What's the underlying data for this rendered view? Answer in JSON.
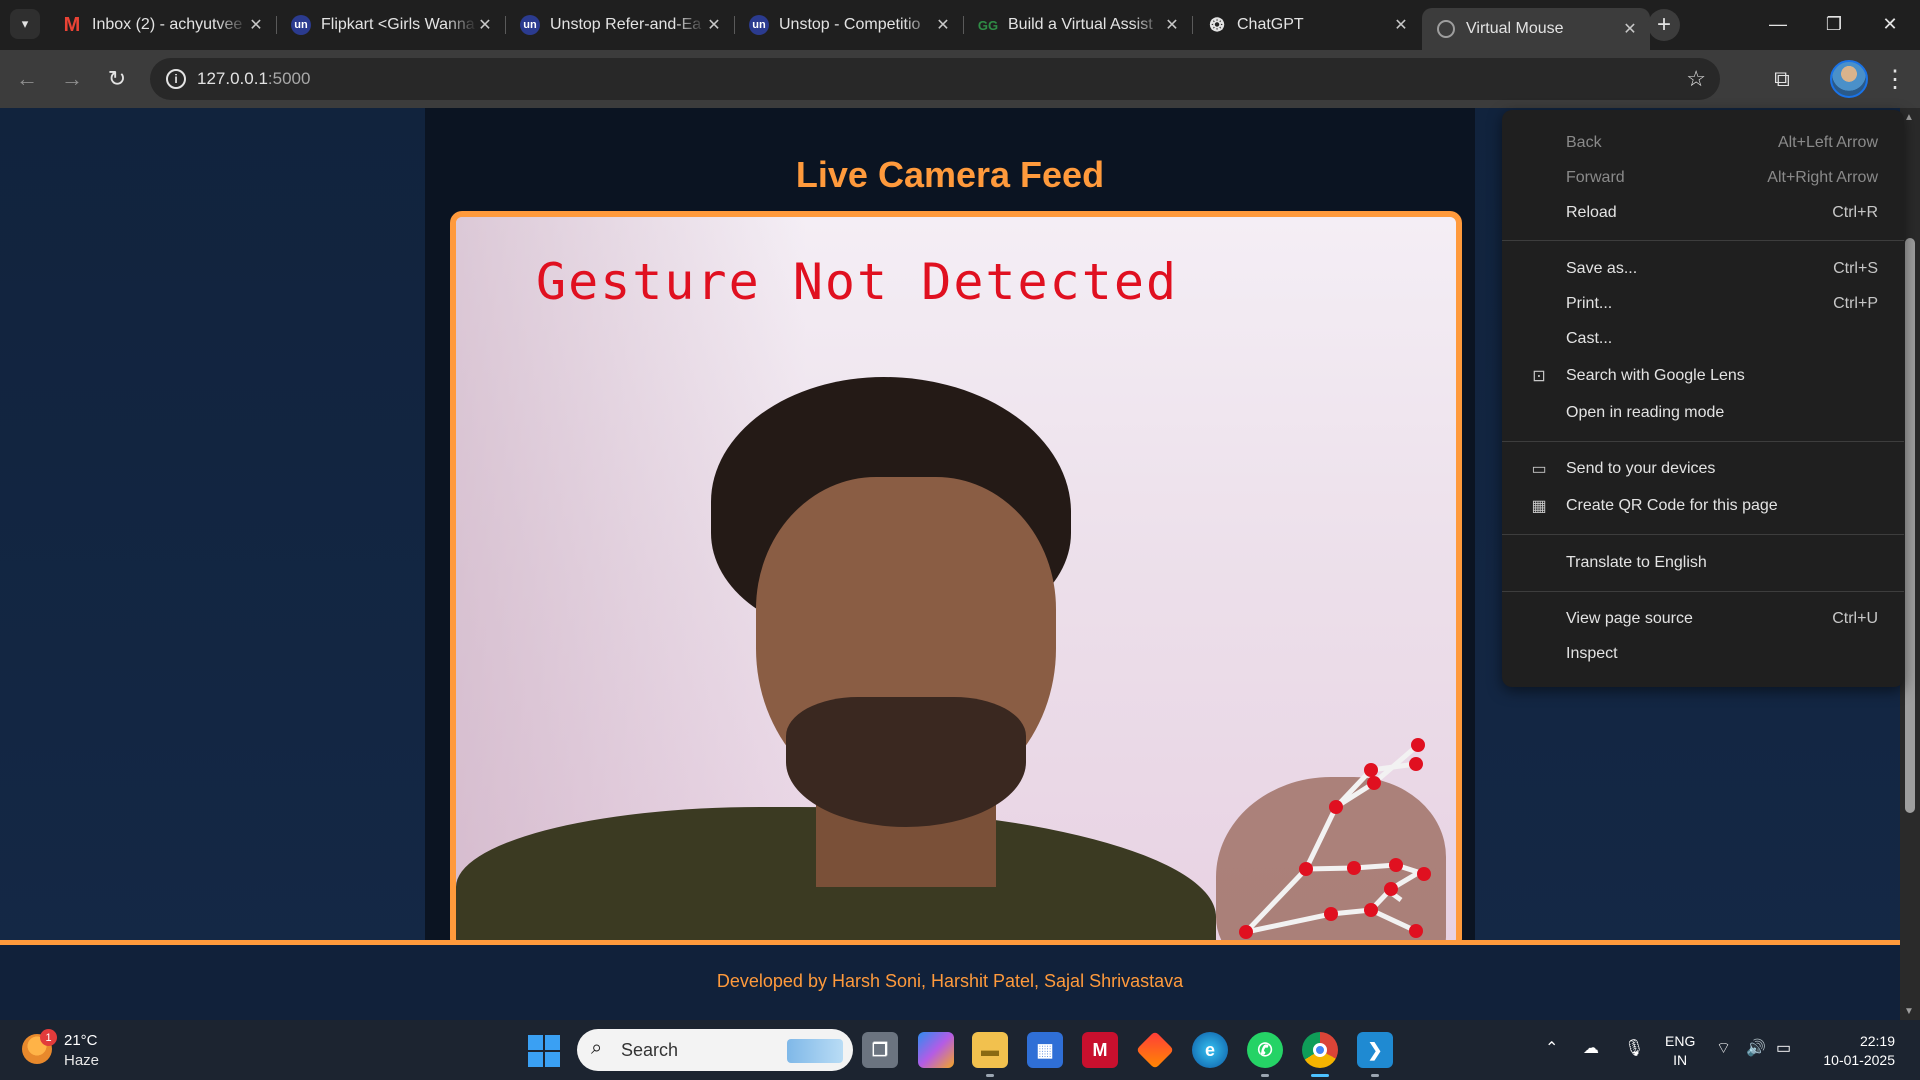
{
  "browser": {
    "tabs": [
      {
        "title": "Inbox (2) - achyutvee",
        "favicon": "gmail-icon"
      },
      {
        "title": "Flipkart <Girls Wanna",
        "favicon": "unstop-icon"
      },
      {
        "title": "Unstop Refer-and-Ea",
        "favicon": "unstop-icon"
      },
      {
        "title": "Unstop - Competitio",
        "favicon": "unstop-icon"
      },
      {
        "title": "Build a Virtual Assist",
        "favicon": "gfg-icon"
      },
      {
        "title": "ChatGPT",
        "favicon": "chatgpt-icon"
      },
      {
        "title": "Virtual Mouse",
        "favicon": "globe-icon",
        "active": true
      }
    ],
    "address": {
      "host": "127.0.0.1",
      "port": ":5000"
    }
  },
  "page": {
    "feed_title": "Live Camera Feed",
    "gesture_status": "Gesture Not Detected",
    "footer": "Developed by Harsh Soni, Harshit Patel, Sajal Shrivastava",
    "accent_color": "#ff9a3c"
  },
  "context_menu": {
    "items": [
      {
        "label": "Back",
        "shortcut": "Alt+Left Arrow",
        "disabled": true
      },
      {
        "label": "Forward",
        "shortcut": "Alt+Right Arrow",
        "disabled": true
      },
      {
        "label": "Reload",
        "shortcut": "Ctrl+R"
      },
      {
        "label": "Save as...",
        "shortcut": "Ctrl+S"
      },
      {
        "label": "Print...",
        "shortcut": "Ctrl+P"
      },
      {
        "label": "Cast...",
        "shortcut": ""
      },
      {
        "label": "Search with Google Lens",
        "shortcut": "",
        "icon": "lens-icon"
      },
      {
        "label": "Open in reading mode",
        "shortcut": ""
      },
      {
        "label": "Send to your devices",
        "shortcut": "",
        "icon": "devices-icon"
      },
      {
        "label": "Create QR Code for this page",
        "shortcut": "",
        "icon": "qr-code-icon"
      },
      {
        "label": "Translate to English",
        "shortcut": ""
      },
      {
        "label": "View page source",
        "shortcut": "Ctrl+U"
      },
      {
        "label": "Inspect",
        "shortcut": ""
      }
    ]
  },
  "taskbar": {
    "weather": {
      "temp": "21°C",
      "condition": "Haze",
      "badge": "1"
    },
    "search_label": "Search",
    "language": {
      "line1": "ENG",
      "line2": "IN"
    },
    "time": "22:19",
    "date": "10-01-2025"
  }
}
